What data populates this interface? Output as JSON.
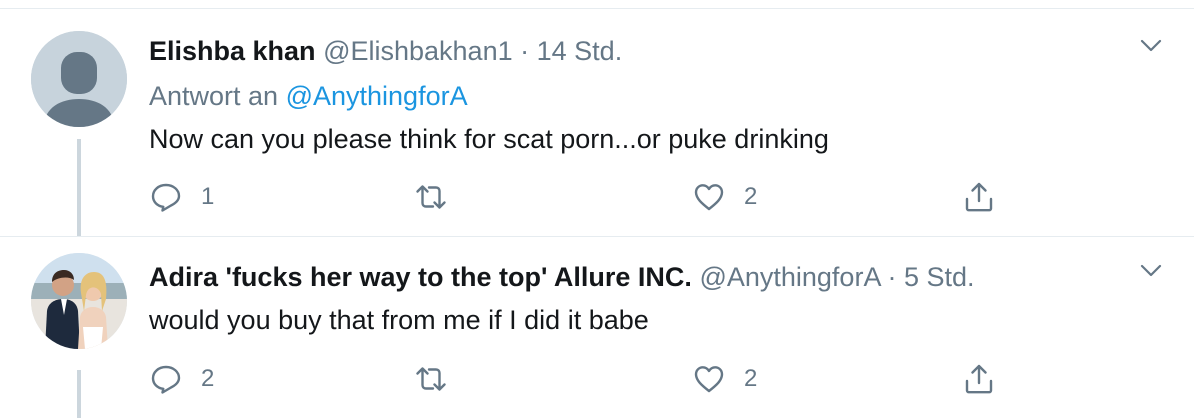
{
  "tweets": [
    {
      "name": "Elishba khan",
      "handle": "@Elishbakhan1",
      "separator": "·",
      "time": "14 Std.",
      "reply_prefix": "Antwort an",
      "reply_mention": "@AnythingforA",
      "text": "Now can you please think for scat porn...or puke drinking",
      "reply_count": "1",
      "like_count": "2",
      "avatar": "default-profile-avatar"
    },
    {
      "name": "Adira 'fucks her way to the top' Allure INC.",
      "handle": "@AnythingforA",
      "separator": "·",
      "time": "5 Std.",
      "text": "would you buy that from me if I did it babe",
      "reply_count": "2",
      "like_count": "2",
      "avatar": "profile-photo-avatar"
    }
  ],
  "colors": {
    "text_primary": "#14171a",
    "text_secondary": "#657786",
    "link": "#1b95e0",
    "divider": "#e6ecf0",
    "thread_line": "#ccd6dd"
  },
  "icons": [
    "reply-icon",
    "retweet-icon",
    "like-icon",
    "share-icon",
    "chevron-down-icon"
  ]
}
